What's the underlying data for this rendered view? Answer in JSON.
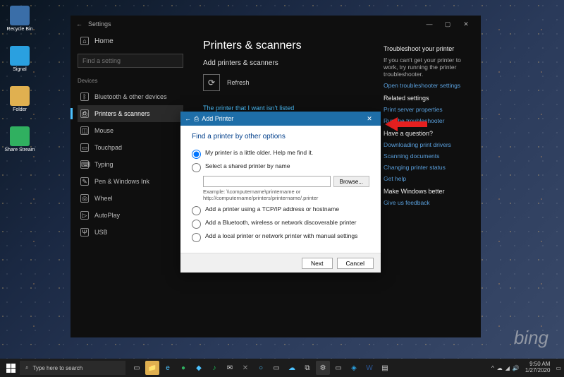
{
  "desktop": {
    "icons": [
      "Recycle Bin",
      "Signal",
      "Folder",
      "Share Stream"
    ],
    "bing": "bing"
  },
  "settings": {
    "title": "Settings",
    "home": "Home",
    "search_placeholder": "Find a setting",
    "section": "Devices",
    "nav": [
      "Bluetooth & other devices",
      "Printers & scanners",
      "Mouse",
      "Touchpad",
      "Typing",
      "Pen & Windows Ink",
      "Wheel",
      "AutoPlay",
      "USB"
    ],
    "main": {
      "heading": "Printers & scanners",
      "subheading": "Add printers & scanners",
      "refresh": "Refresh",
      "not_listed": "The printer that I want isn't listed"
    },
    "right": {
      "h1": "Troubleshoot your printer",
      "p1": "If you can't get your printer to work, try running the printer troubleshooter.",
      "l1": "Open troubleshooter settings",
      "h2": "Related settings",
      "l2": "Print server properties",
      "l3": "Run the troubleshooter",
      "h3": "Have a question?",
      "l4": "Downloading print drivers",
      "l5": "Scanning documents",
      "l6": "Changing printer status",
      "l7": "Get help",
      "h4": "Make Windows better",
      "l8": "Give us feedback"
    }
  },
  "dialog": {
    "title": "Add Printer",
    "heading": "Find a printer by other options",
    "opts": [
      "My printer is a little older. Help me find it.",
      "Select a shared printer by name",
      "Add a printer using a TCP/IP address or hostname",
      "Add a Bluetooth, wireless or network discoverable printer",
      "Add a local printer or network printer with manual settings"
    ],
    "browse": "Browse...",
    "example": "Example: \\\\computername\\printername or http://computername/printers/printername/.printer",
    "next": "Next",
    "cancel": "Cancel"
  },
  "taskbar": {
    "search": "Type here to search",
    "time": "9:50 AM",
    "date": "1/27/2020"
  }
}
